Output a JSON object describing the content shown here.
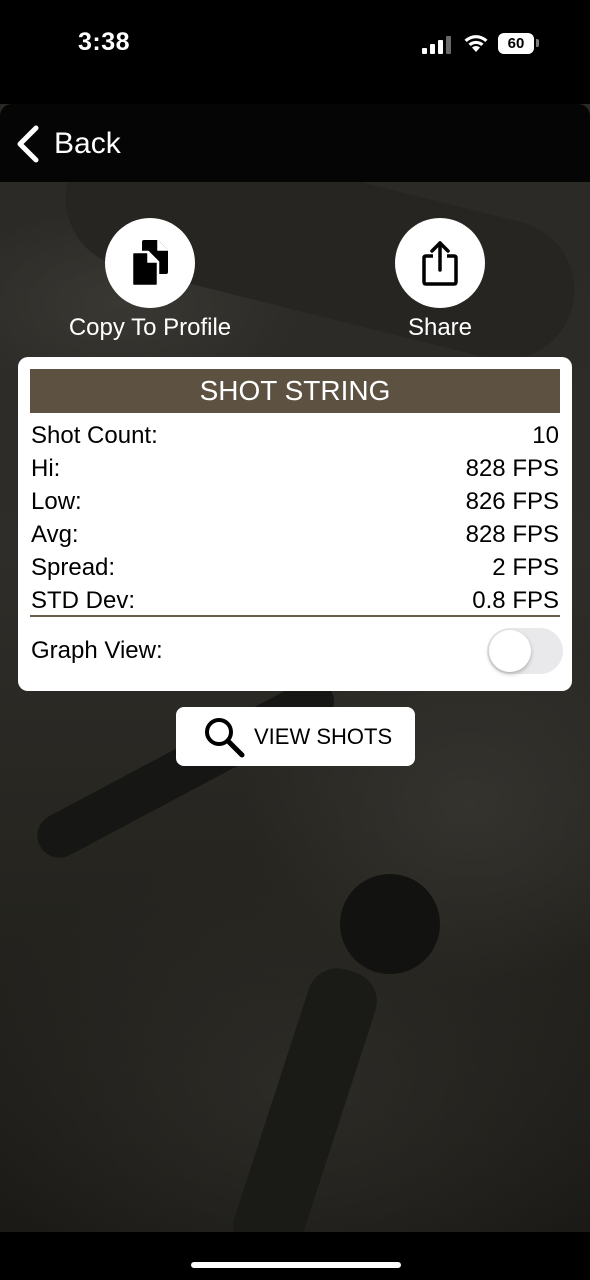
{
  "status_bar": {
    "time": "3:38",
    "battery": "60"
  },
  "nav": {
    "back_label": "Back"
  },
  "actions": {
    "copy_label": "Copy To Profile",
    "share_label": "Share"
  },
  "card": {
    "title": "SHOT STRING",
    "rows": [
      {
        "label": "Shot Count:",
        "value": "10"
      },
      {
        "label": "Hi:",
        "value": "828 FPS"
      },
      {
        "label": "Low:",
        "value": "826 FPS"
      },
      {
        "label": "Avg:",
        "value": "828 FPS"
      },
      {
        "label": "Spread:",
        "value": "2 FPS"
      },
      {
        "label": "STD Dev:",
        "value": "0.8 FPS"
      }
    ],
    "graph_view_label": "Graph View:",
    "graph_view_on": false
  },
  "view_shots_label": "VIEW SHOTS",
  "colors": {
    "header_bg": "#5d5242",
    "divider": "#6a5f4e",
    "toggle_off": "#e9e9eb"
  }
}
